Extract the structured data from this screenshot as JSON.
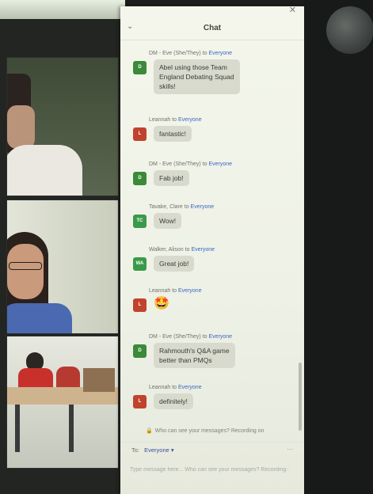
{
  "chat": {
    "title": "Chat",
    "messages": [
      {
        "sender": "DM - Eve (She/They)",
        "to_word": "to",
        "recipient": "Everyone",
        "avatar": "D",
        "avatar_color": "#3a8a3a",
        "lines": [
          "Abel using those Team",
          "England Debating Squad",
          "skills!"
        ]
      },
      {
        "sender": "Leannah",
        "to_word": "to",
        "recipient": "Everyone",
        "avatar": "L",
        "avatar_color": "#c0432e",
        "lines": [
          "fantastic!"
        ]
      },
      {
        "sender": "DM - Eve (She/They)",
        "to_word": "to",
        "recipient": "Everyone",
        "avatar": "D",
        "avatar_color": "#3a8a3a",
        "lines": [
          "Fab job!"
        ]
      },
      {
        "sender": "Tavake, Clare",
        "to_word": "to",
        "recipient": "Everyone",
        "avatar": "TC",
        "avatar_color": "#3a9a4a",
        "lines": [
          "Wow!"
        ]
      },
      {
        "sender": "Walker, Alison",
        "to_word": "to",
        "recipient": "Everyone",
        "avatar": "WA",
        "avatar_color": "#3a9a4a",
        "lines": [
          "Great job!"
        ]
      },
      {
        "sender": "Leannah",
        "to_word": "to",
        "recipient": "Everyone",
        "avatar": "L",
        "avatar_color": "#c0432e",
        "emoji": "🤩"
      },
      {
        "sender": "DM - Eve (She/They)",
        "to_word": "to",
        "recipient": "Everyone",
        "avatar": "D",
        "avatar_color": "#3a8a3a",
        "lines": [
          "Rahmouth's Q&A game",
          "better than PMQs"
        ]
      },
      {
        "sender": "Leannah",
        "to_word": "to",
        "recipient": "Everyone",
        "avatar": "L",
        "avatar_color": "#c0432e",
        "lines": [
          "definitely!"
        ]
      }
    ],
    "privacy_note": "Who can see your messages? Recording on",
    "to_label": "To:",
    "recipient_select": "Everyone ▾",
    "input_placeholder": "Type message here... Who can see your messages? Recording on"
  }
}
